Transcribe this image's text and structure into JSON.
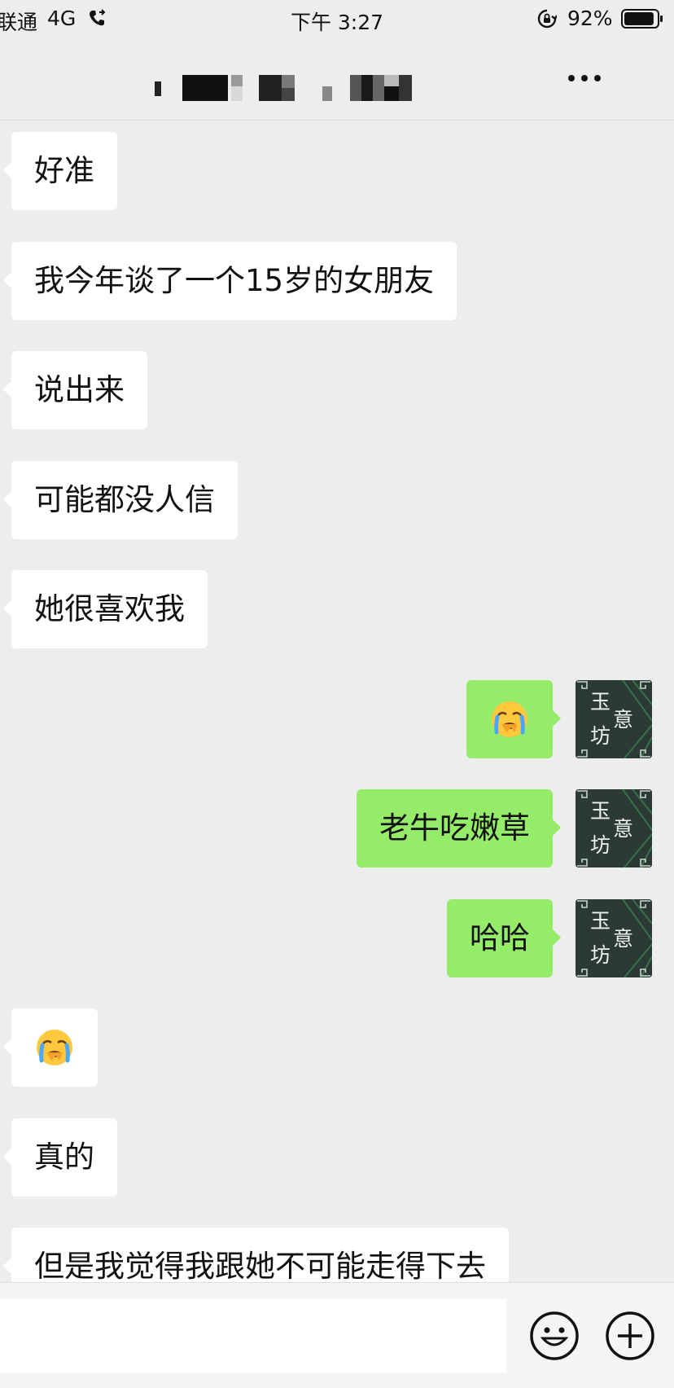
{
  "status_bar": {
    "carrier": "联通",
    "network": "4G",
    "time": "下午 3:27",
    "battery": "92%",
    "battery_level": 0.92
  },
  "header": {
    "title_obscured": true,
    "more_icon": "more-icon"
  },
  "messages": [
    {
      "side": "incoming",
      "type": "text",
      "text": "好准"
    },
    {
      "side": "incoming",
      "type": "text",
      "text": "我今年谈了一个15岁的女朋友"
    },
    {
      "side": "incoming",
      "type": "text",
      "text": "说出来"
    },
    {
      "side": "incoming",
      "type": "text",
      "text": "可能都没人信"
    },
    {
      "side": "incoming",
      "type": "text",
      "text": "她很喜欢我"
    },
    {
      "side": "outgoing",
      "type": "emoji",
      "emoji": "😭"
    },
    {
      "side": "outgoing",
      "type": "text",
      "text": "老牛吃嫩草"
    },
    {
      "side": "outgoing",
      "type": "text",
      "text": "哈哈"
    },
    {
      "side": "incoming",
      "type": "emoji",
      "emoji": "😭"
    },
    {
      "side": "incoming",
      "type": "text",
      "text": "真的"
    },
    {
      "side": "incoming",
      "type": "text",
      "text": "但是我觉得我跟她不可能走得下去"
    }
  ],
  "avatar": {
    "chars": [
      "玉",
      "意",
      "坊"
    ]
  },
  "input": {
    "value": "",
    "emoji_icon": "smiley-icon",
    "plus_icon": "plus-circle-icon"
  },
  "colors": {
    "background": "#ededed",
    "incoming_bubble": "#ffffff",
    "outgoing_bubble": "#95ec69",
    "avatar_bg": "#2c3c36"
  }
}
